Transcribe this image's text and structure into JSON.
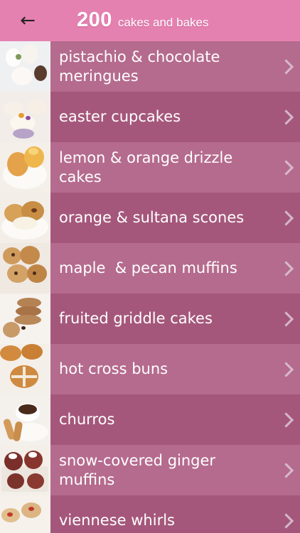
{
  "header": {
    "number": "200",
    "subtitle": "cakes and bakes",
    "back_icon": "arrow-left-icon"
  },
  "recipes": [
    {
      "label": "pistachio & chocolate\nmeringues"
    },
    {
      "label": "easter cupcakes"
    },
    {
      "label": "lemon & orange drizzle\ncakes"
    },
    {
      "label": "orange & sultana scones"
    },
    {
      "label": "maple  & pecan muffins"
    },
    {
      "label": "fruited griddle cakes"
    },
    {
      "label": "hot cross buns"
    },
    {
      "label": "churros"
    },
    {
      "label": "snow-covered ginger\nmuffins"
    },
    {
      "label": "viennese whirls"
    }
  ],
  "colors": {
    "header_bg": "#e581b1",
    "row_odd": "#a5577b",
    "row_even": "#b56b8e",
    "text": "#ffffff",
    "chevron": "#d9c3cf"
  }
}
